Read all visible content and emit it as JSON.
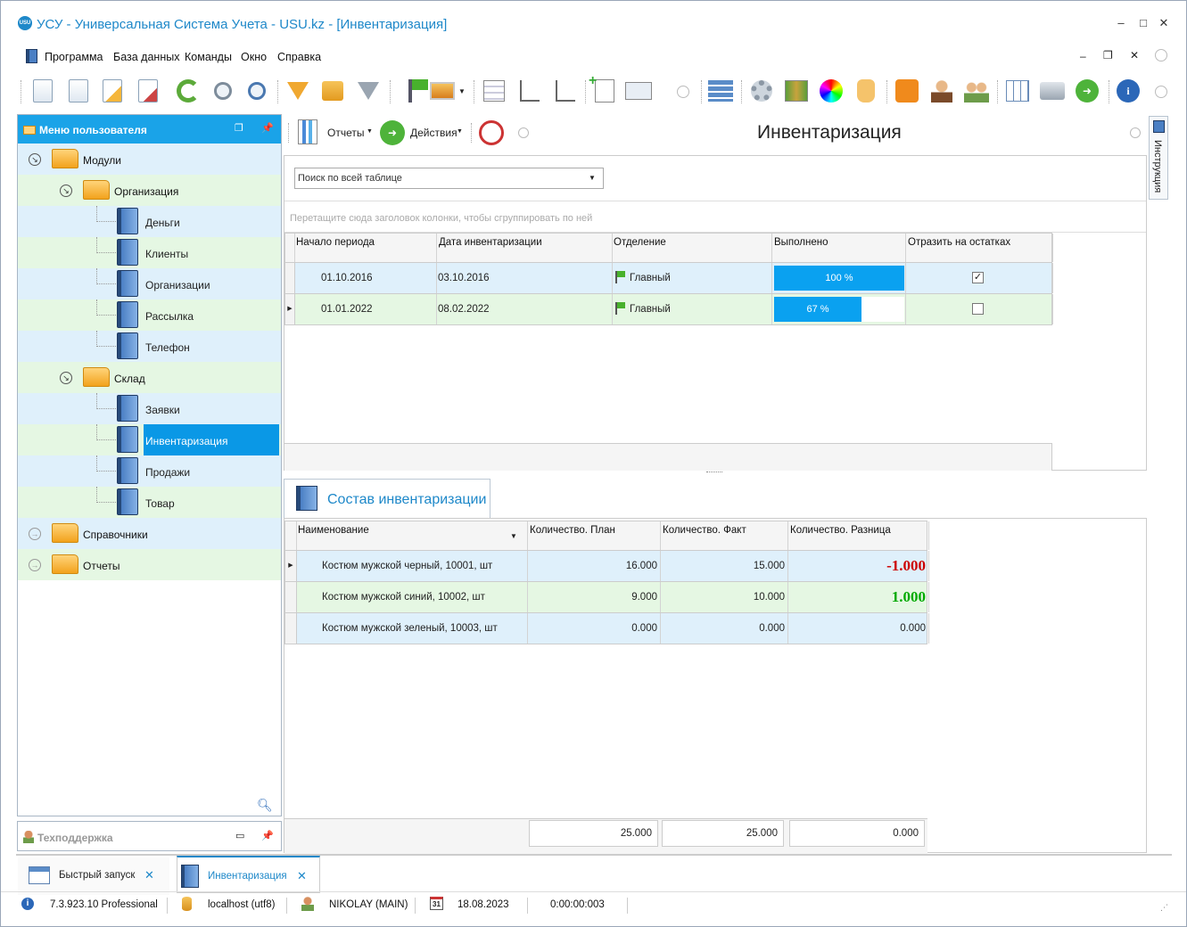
{
  "window": {
    "title": "УСУ - Универсальная Система Учета - USU.kz - [Инвентаризация]",
    "logo": "USU"
  },
  "menu": [
    "Программа",
    "База данных",
    "Команды",
    "Окно",
    "Справка"
  ],
  "left_panel": {
    "title": "Меню пользователя",
    "tree": [
      {
        "label": "Модули",
        "level": 0,
        "type": "folder",
        "expander": "expanded"
      },
      {
        "label": "Организация",
        "level": 1,
        "type": "folder",
        "expander": "expanded"
      },
      {
        "label": "Деньги",
        "level": 2,
        "type": "book"
      },
      {
        "label": "Клиенты",
        "level": 2,
        "type": "book"
      },
      {
        "label": "Организации",
        "level": 2,
        "type": "book"
      },
      {
        "label": "Рассылка",
        "level": 2,
        "type": "book"
      },
      {
        "label": "Телефон",
        "level": 2,
        "type": "book"
      },
      {
        "label": "Склад",
        "level": 1,
        "type": "folder",
        "expander": "expanded"
      },
      {
        "label": "Заявки",
        "level": 2,
        "type": "book"
      },
      {
        "label": "Инвентаризация",
        "level": 2,
        "type": "book",
        "selected": true
      },
      {
        "label": "Продажи",
        "level": 2,
        "type": "book"
      },
      {
        "label": "Товар",
        "level": 2,
        "type": "book"
      },
      {
        "label": "Справочники",
        "level": 0,
        "type": "folder",
        "expander": "collapsed"
      },
      {
        "label": "Отчеты",
        "level": 0,
        "type": "folder",
        "expander": "collapsed"
      }
    ]
  },
  "support": {
    "title": "Техподдержка"
  },
  "content_toolbar": {
    "reports": "Отчеты",
    "actions": "Действия",
    "page_title": "Инвентаризация"
  },
  "side_tab": "Инструкция",
  "search": {
    "placeholder": "Поиск по всей таблице"
  },
  "group_hint": "Перетащите сюда заголовок колонки, чтобы сгруппировать по ней",
  "inventory_table": {
    "columns": [
      "Начало периода",
      "Дата инвентаризации",
      "Отделение",
      "Выполнено",
      "Отразить на остатках"
    ],
    "rows": [
      {
        "start": "01.10.2016",
        "date": "03.10.2016",
        "dept": "Главный",
        "done_label": "100 %",
        "done": 1.0,
        "reflect": true
      },
      {
        "start": "01.01.2022",
        "date": "08.02.2022",
        "dept": "Главный",
        "done_label": "67 %",
        "done": 0.67,
        "reflect": false
      }
    ]
  },
  "detail_tab": "Состав инвентаризации",
  "detail_table": {
    "columns": [
      "Наименование",
      "Количество. План",
      "Количество. Факт",
      "Количество. Разница"
    ],
    "rows": [
      {
        "name": "Костюм мужской черный, 10001, шт",
        "plan": "16.000",
        "fact": "15.000",
        "diff": "-1.000",
        "diff_style": "red"
      },
      {
        "name": "Костюм мужской синий, 10002, шт",
        "plan": "9.000",
        "fact": "10.000",
        "diff": "1.000",
        "diff_style": "green"
      },
      {
        "name": "Костюм мужской зеленый, 10003, шт",
        "plan": "0.000",
        "fact": "0.000",
        "diff": "0.000",
        "diff_style": "normal"
      }
    ],
    "totals": {
      "plan": "25.000",
      "fact": "25.000",
      "diff": "0.000"
    }
  },
  "bottom_tabs": [
    {
      "label": "Быстрый запуск",
      "active": false
    },
    {
      "label": "Инвентаризация",
      "active": true
    }
  ],
  "status": {
    "version": "7.3.923.10 Professional",
    "db": "localhost (utf8)",
    "user": "NIKOLAY (MAIN)",
    "date": "18.08.2023",
    "calendar_day": "31",
    "timer": "0:00:00:003"
  },
  "colors": {
    "accent": "#1aa3e8",
    "selected": "#0a98e6",
    "row_blue": "#dff0fb",
    "row_green": "#e5f7e3",
    "negative": "#cc0000",
    "positive": "#00aa00"
  }
}
